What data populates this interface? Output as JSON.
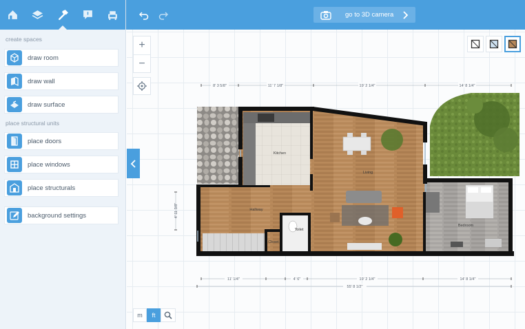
{
  "sidebar": {
    "tabs": [
      {
        "icon": "house-icon"
      },
      {
        "icon": "layers-icon"
      },
      {
        "icon": "hammer-icon"
      },
      {
        "icon": "comment-icon"
      },
      {
        "icon": "armchair-icon"
      }
    ],
    "create_spaces_label": "create spaces",
    "create_tools": [
      {
        "icon": "room-icon",
        "label": "draw room"
      },
      {
        "icon": "wall-icon",
        "label": "draw wall"
      },
      {
        "icon": "surface-icon",
        "label": "draw surface"
      }
    ],
    "structural_label": "place structural units",
    "structural_tools": [
      {
        "icon": "door-icon",
        "label": "place doors"
      },
      {
        "icon": "window-icon",
        "label": "place windows"
      },
      {
        "icon": "structural-icon",
        "label": "place structurals"
      }
    ],
    "background_tool": {
      "icon": "edit-icon",
      "label": "background settings"
    }
  },
  "topbar": {
    "camera_label": "go to 3D camera"
  },
  "canvas": {
    "units": [
      "m",
      "ft"
    ],
    "active_unit": "ft",
    "dimensions_top": [
      "8' 3 5/8\"",
      "11' 7 1/8\"",
      "19' 2 1/4\"",
      "14' 8 1/4\""
    ],
    "dimensions_bottom": [
      "11' 1/4\"",
      "4' 6\"",
      "19' 2 1/4\"",
      "14' 8 1/4\""
    ],
    "dimension_total": "55' 8 1/2\"",
    "dimension_left": "4' 11 3/8\"",
    "rooms": {
      "kitchen": "Kitchen",
      "living": "Living",
      "hallway": "Hallway",
      "toilet": "Toilet",
      "closet": "Closet",
      "bedroom": "Bedroom"
    }
  },
  "colors": {
    "accent": "#4a9fde",
    "sidebar_bg": "#edf3f9",
    "wood": "#b88a5a",
    "wall": "#111111"
  }
}
